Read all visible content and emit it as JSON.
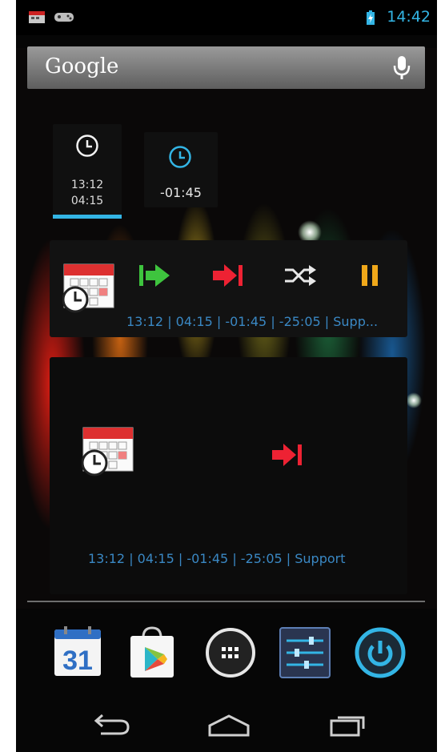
{
  "status_bar": {
    "time": "14:42"
  },
  "search": {
    "label": "Google"
  },
  "clock_widget_1": {
    "line1": "13:12",
    "line2": "04:15"
  },
  "clock_widget_2": {
    "value": "-01:45"
  },
  "widget_large": {
    "status": "13:12 | 04:15 | -01:45 | -25:05 | Supp..."
  },
  "widget_full": {
    "status": "13:12 | 04:15 | -01:45 | -25:05 | Support"
  },
  "dock": {
    "calendar_date": "31"
  },
  "colors": {
    "accent": "#33b5e5",
    "green": "#3ec43e",
    "red": "#ee2233",
    "orange": "#f0a81a",
    "status_text": "#3a88c4"
  }
}
